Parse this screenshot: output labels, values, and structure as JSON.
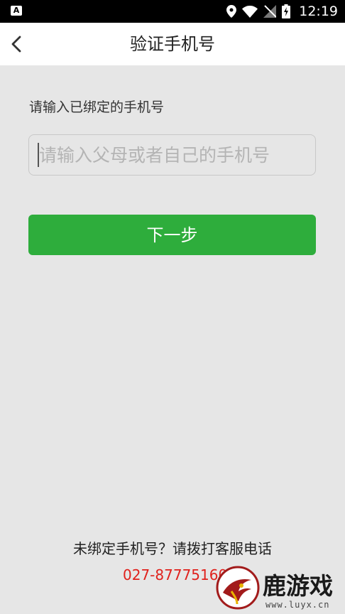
{
  "status_bar": {
    "notification_icon": "a-icon",
    "time": "12:19",
    "icons": [
      "location-icon",
      "wifi-icon",
      "no-sim-icon",
      "battery-charging-icon"
    ]
  },
  "app_bar": {
    "back_icon": "chevron-left-icon",
    "title": "验证手机号"
  },
  "form": {
    "label": "请输入已绑定的手机号",
    "phone_input": {
      "value": "",
      "placeholder": "请输入父母或者自己的手机号"
    },
    "next_button": "下一步"
  },
  "footer": {
    "help_text": "未绑定手机号？请拨打客服电话",
    "phone_number": "027-87775160"
  },
  "watermark": {
    "name": "鹿游戏",
    "url": "www.luyx.cn"
  },
  "colors": {
    "primary_green": "#2ead3c",
    "phone_red": "#e0211c",
    "background": "#e6e6e6"
  }
}
